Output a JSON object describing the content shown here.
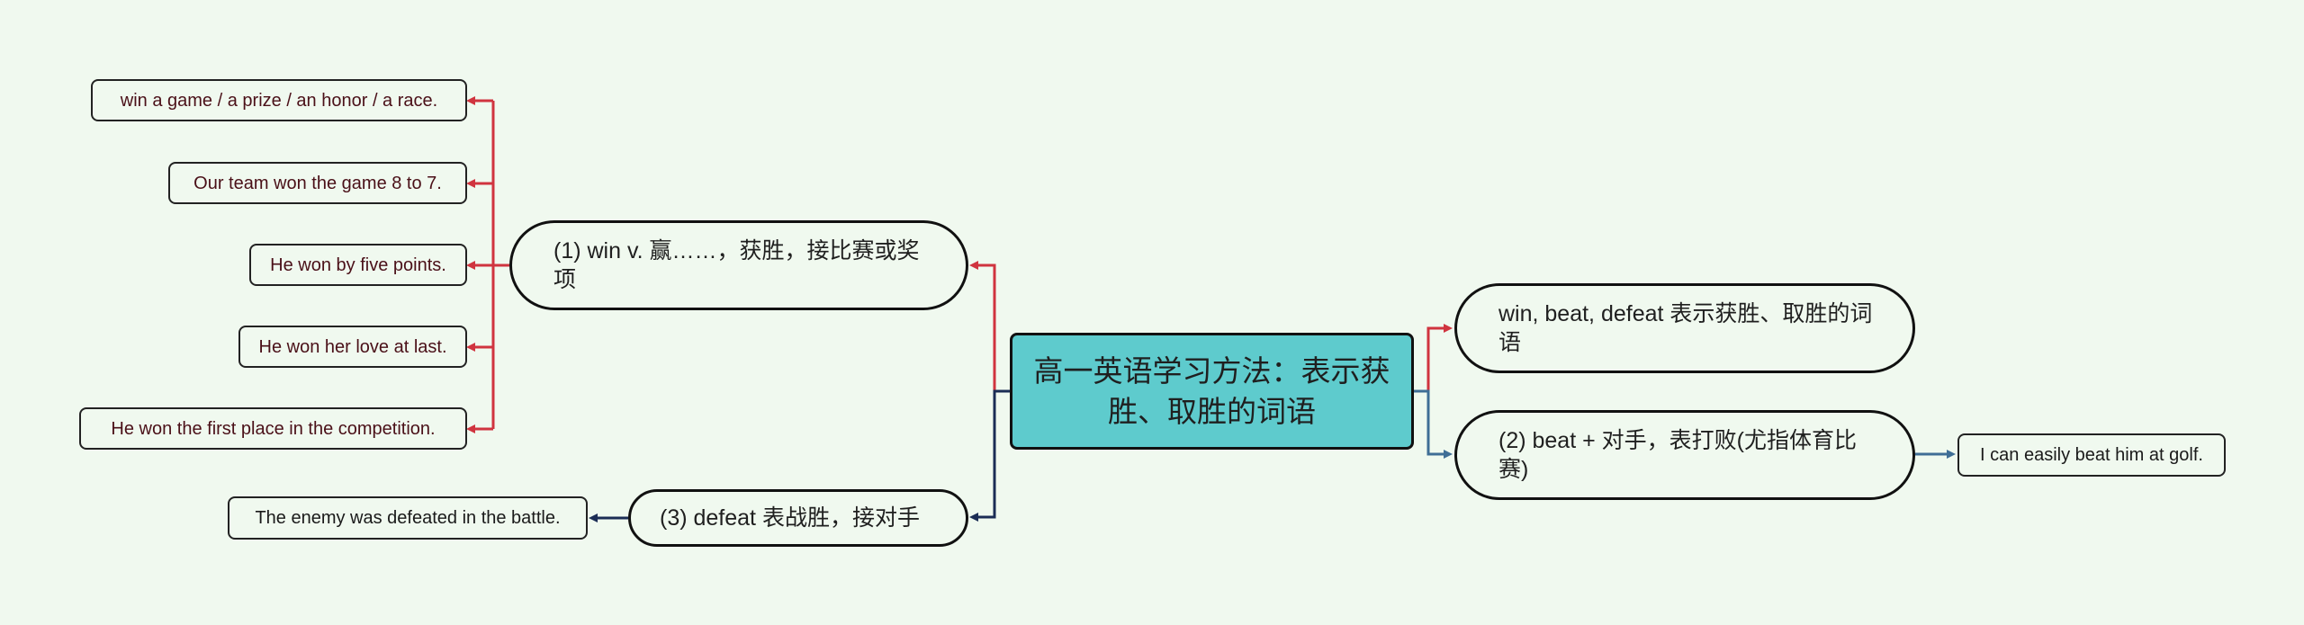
{
  "root": {
    "title": "高一英语学习方法：表示获胜、取胜的词语",
    "background": "#5ecbcd"
  },
  "branches": {
    "left_win": {
      "label": "(1) win v. 赢……，获胜，接比赛或奖项",
      "color": "#d0343f",
      "examples": [
        "win a game / a prize / an honor / a race.",
        "Our team won the game 8 to 7.",
        "He won by five points.",
        "He won her love at last.",
        "He won the first place in the competition."
      ]
    },
    "left_defeat": {
      "label": "(3) defeat 表战胜，接对手",
      "color": "#1b2d55",
      "examples": [
        "The enemy was defeated in the battle."
      ]
    },
    "right_intro": {
      "label": "win, beat, defeat 表示获胜、取胜的词语",
      "color": "#d0343f"
    },
    "right_beat": {
      "label": "(2) beat + 对手，表打败(尤指体育比赛)",
      "color": "#3f6e96",
      "examples": [
        "I can easily beat him at golf."
      ]
    }
  },
  "background_color": "#f0f9ef"
}
